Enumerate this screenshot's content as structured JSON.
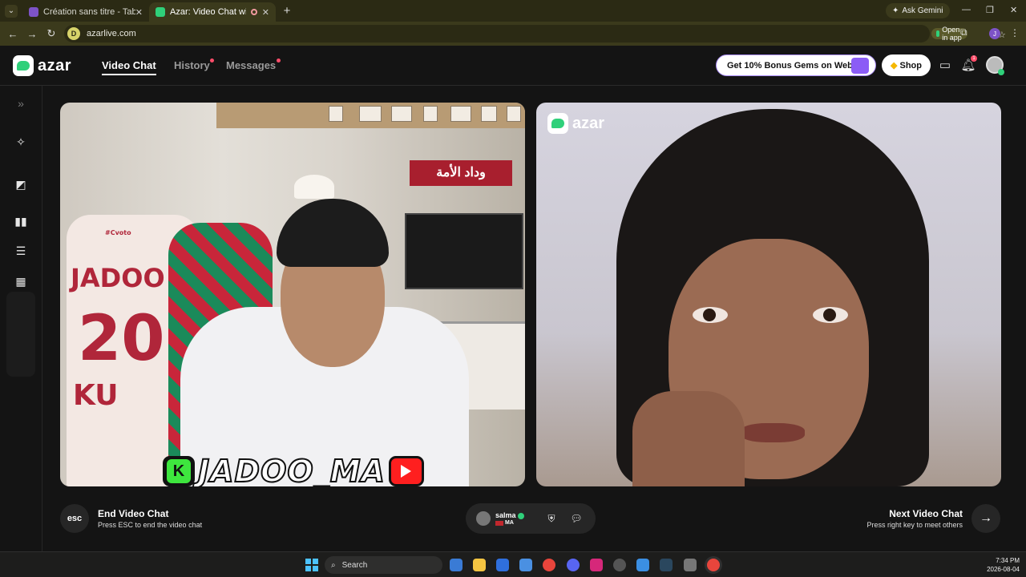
{
  "browser": {
    "tabs": [
      {
        "title": "Création sans titre - Tableau bla",
        "favicon_color": "#7d53c7"
      },
      {
        "title": "Azar: Video Chat with New",
        "favicon_color": "#2fd07a"
      }
    ],
    "ask_gemini": "Ask Gemini",
    "url": "azarlive.com",
    "open_in_app": "Open in app",
    "profile_initial": "J"
  },
  "header": {
    "logo_text": "azar",
    "nav": [
      {
        "label": "Video Chat",
        "active": true
      },
      {
        "label": "History",
        "dot": true
      },
      {
        "label": "Messages",
        "dot": true
      }
    ],
    "promo": "Get 10% Bonus Gems on Web!",
    "shop": "Shop",
    "notification_count": "1"
  },
  "sidebar": {
    "icons": [
      "expand-icon",
      "magic-wand-icon",
      "effects-icon",
      "layout-side-by-side-icon",
      "layout-stacked-icon",
      "layout-grid-icon"
    ]
  },
  "video_left": {
    "jersey_name": "JADOO",
    "jersey_number": "20",
    "jersey_partial": "KU",
    "jersey_small": "#Cvoto",
    "scarf_text": "وداد الأمة",
    "streamer_tag": "JADOO_MA",
    "tag_letter": "K"
  },
  "video_right": {
    "watermark": "azar"
  },
  "controls": {
    "esc_label": "esc",
    "end_title": "End Video Chat",
    "end_subtitle": "Press ESC to end the video chat",
    "peer_name": "salma",
    "peer_country": "MA",
    "next_title": "Next Video Chat",
    "next_subtitle": "Press right key to meet others"
  },
  "taskbar": {
    "search": "Search",
    "time": "7:34 PM",
    "date": "2026-08-04"
  },
  "colors": {
    "accent_green": "#2fd07a",
    "notification_red": "#ff4d6a",
    "promo_border": "#a98cf5"
  }
}
